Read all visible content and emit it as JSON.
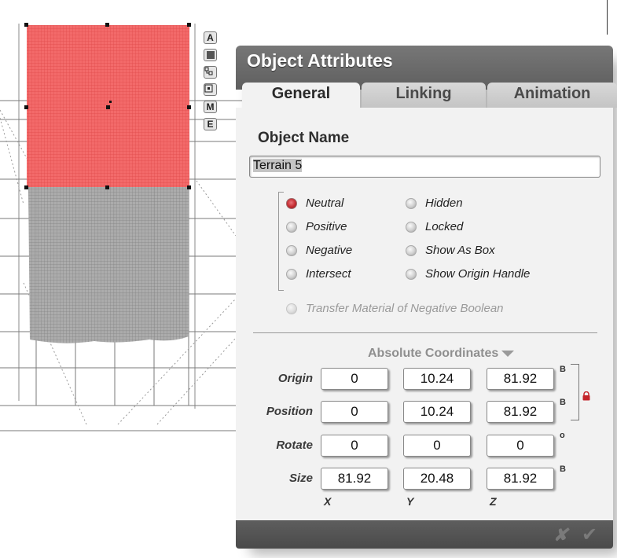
{
  "viewport": {
    "side_buttons": [
      {
        "icon": "a-letter-icon",
        "label": "A"
      },
      {
        "icon": "material-square-icon",
        "label": ""
      },
      {
        "icon": "hierarchy-icon",
        "label": ""
      },
      {
        "icon": "select-frame-icon",
        "label": ""
      },
      {
        "icon": "m-letter-icon",
        "label": "M"
      },
      {
        "icon": "e-letter-icon",
        "label": "E"
      }
    ]
  },
  "panel": {
    "title": "Object Attributes",
    "tabs": [
      {
        "label": "General",
        "active": true
      },
      {
        "label": "Linking",
        "active": false
      },
      {
        "label": "Animation",
        "active": false
      }
    ],
    "object_name_label": "Object Name",
    "object_name_value": "Terrain 5",
    "options_left": [
      {
        "label": "Neutral",
        "selected": true
      },
      {
        "label": "Positive",
        "selected": false
      },
      {
        "label": "Negative",
        "selected": false
      },
      {
        "label": "Intersect",
        "selected": false
      }
    ],
    "options_right": [
      {
        "label": "Hidden",
        "selected": false
      },
      {
        "label": "Locked",
        "selected": false
      },
      {
        "label": "Show As Box",
        "selected": false
      },
      {
        "label": "Show Origin Handle",
        "selected": false
      }
    ],
    "transfer_material": {
      "label": "Transfer Material of Negative Boolean",
      "enabled": false
    },
    "coordinates_mode": "Absolute Coordinates",
    "rows": [
      {
        "label": "Origin",
        "x": "0",
        "y": "10.24",
        "z": "81.92",
        "unit": "B"
      },
      {
        "label": "Position",
        "x": "0",
        "y": "10.24",
        "z": "81.92",
        "unit": "B"
      },
      {
        "label": "Rotate",
        "x": "0",
        "y": "0",
        "z": "0",
        "unit": "o"
      },
      {
        "label": "Size",
        "x": "81.92",
        "y": "20.48",
        "z": "81.92",
        "unit": "B"
      }
    ],
    "axis_labels": [
      "X",
      "Y",
      "Z"
    ],
    "footer": {
      "cancel": "✘",
      "ok": "✔"
    }
  },
  "colors": {
    "selection_red": "#f15a5a",
    "terrain_gray": "#9a9a9a",
    "panel_bg": "#f2f2f2",
    "panel_header": "#666666",
    "radio_on": "#c42b30",
    "lock_red": "#c4242a"
  }
}
